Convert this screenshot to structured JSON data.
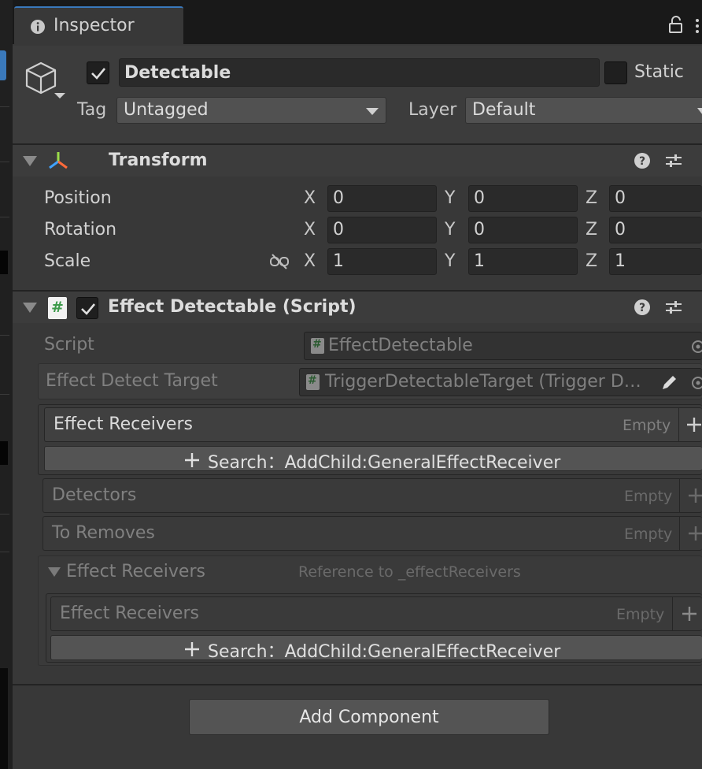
{
  "window": {
    "tab_label": "Inspector"
  },
  "gameobject": {
    "name": "Detectable",
    "active": true,
    "static_label": "Static",
    "tag_label": "Tag",
    "tag_value": "Untagged",
    "layer_label": "Layer",
    "layer_value": "Default"
  },
  "transform": {
    "title": "Transform",
    "rows": [
      {
        "label": "Position",
        "x": "0",
        "y": "0",
        "z": "0"
      },
      {
        "label": "Rotation",
        "x": "0",
        "y": "0",
        "z": "0"
      },
      {
        "label": "Scale",
        "x": "1",
        "y": "1",
        "z": "1"
      }
    ],
    "axis": {
      "x": "X",
      "y": "Y",
      "z": "Z"
    }
  },
  "script_component": {
    "title": "Effect Detectable (Script)",
    "enabled": true,
    "script_label": "Script",
    "script_value": "EffectDetectable",
    "target_label": "Effect Detect Target",
    "target_value": "TriggerDetectableTarget (Trigger D…",
    "receivers_label": "Effect Receivers",
    "empty_label": "Empty",
    "search_button": "Search：AddChild:GeneralEffectReceiver",
    "detectors_label": "Detectors",
    "to_removes_label": "To Removes",
    "ref_group_label": "Effect Receivers",
    "ref_hint": "Reference to _effectReceivers",
    "inner_receivers_label": "Effect Receivers",
    "inner_search_button": "Search：AddChild:GeneralEffectReceiver"
  },
  "footer": {
    "add_component": "Add Component"
  },
  "colors": {
    "accent": "#3a79bb",
    "checkbox_check": "#e0e0e0",
    "script_icon": "#3c9a4a"
  }
}
